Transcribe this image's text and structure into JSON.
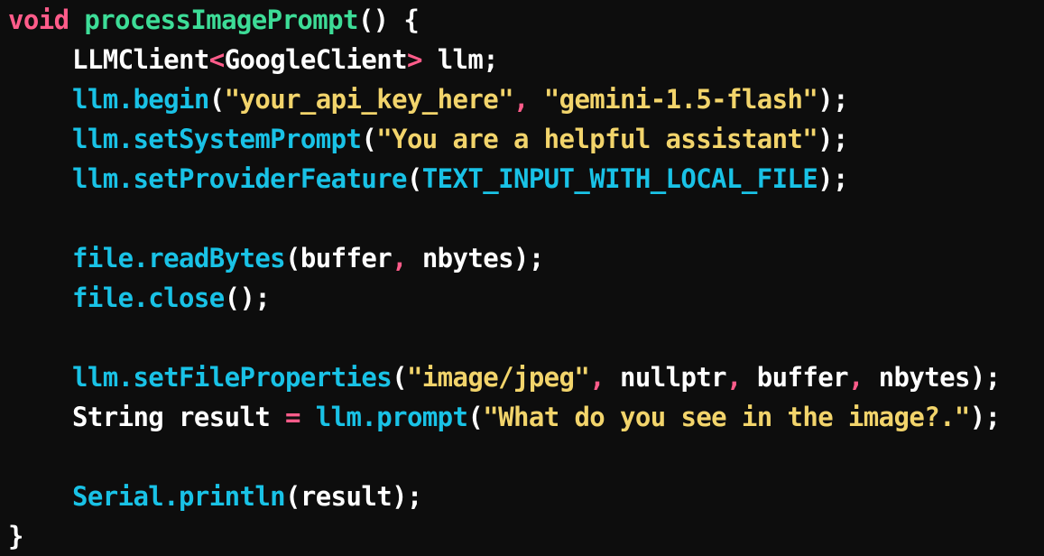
{
  "code": {
    "lines": [
      [
        {
          "t": "void",
          "c": "kw"
        },
        {
          "t": " ",
          "c": "plain"
        },
        {
          "t": "processImagePrompt",
          "c": "fn"
        },
        {
          "t": "() {",
          "c": "plain"
        }
      ],
      [
        {
          "t": "LLMClient",
          "c": "plain"
        },
        {
          "t": "<",
          "c": "punct-red"
        },
        {
          "t": "GoogleClient",
          "c": "plain"
        },
        {
          "t": ">",
          "c": "punct-red"
        },
        {
          "t": " llm;",
          "c": "plain"
        }
      ],
      [
        {
          "t": "llm.begin",
          "c": "obj"
        },
        {
          "t": "(",
          "c": "plain"
        },
        {
          "t": "\"your_api_key_here\"",
          "c": "str"
        },
        {
          "t": ",",
          "c": "punct-red"
        },
        {
          "t": " ",
          "c": "plain"
        },
        {
          "t": "\"gemini-1.5-flash\"",
          "c": "str"
        },
        {
          "t": ");",
          "c": "plain"
        }
      ],
      [
        {
          "t": "llm.setSystemPrompt",
          "c": "obj"
        },
        {
          "t": "(",
          "c": "plain"
        },
        {
          "t": "\"You are a helpful assistant\"",
          "c": "str"
        },
        {
          "t": ");",
          "c": "plain"
        }
      ],
      [
        {
          "t": "llm.setProviderFeature",
          "c": "obj"
        },
        {
          "t": "(",
          "c": "plain"
        },
        {
          "t": "TEXT_INPUT_WITH_LOCAL_FILE",
          "c": "const"
        },
        {
          "t": ");",
          "c": "plain"
        }
      ],
      [],
      [
        {
          "t": "file.readBytes",
          "c": "obj"
        },
        {
          "t": "(buffer",
          "c": "plain"
        },
        {
          "t": ",",
          "c": "punct-red"
        },
        {
          "t": " nbytes);",
          "c": "plain"
        }
      ],
      [
        {
          "t": "file.close",
          "c": "obj"
        },
        {
          "t": "();",
          "c": "plain"
        }
      ],
      [],
      [
        {
          "t": "llm.setFileProperties",
          "c": "obj"
        },
        {
          "t": "(",
          "c": "plain"
        },
        {
          "t": "\"image/jpeg\"",
          "c": "str"
        },
        {
          "t": ",",
          "c": "punct-red"
        },
        {
          "t": " nullptr",
          "c": "plain"
        },
        {
          "t": ",",
          "c": "punct-red"
        },
        {
          "t": " buffer",
          "c": "plain"
        },
        {
          "t": ",",
          "c": "punct-red"
        },
        {
          "t": " nbytes);",
          "c": "plain"
        }
      ],
      [
        {
          "t": "String result ",
          "c": "plain"
        },
        {
          "t": "=",
          "c": "punct-red"
        },
        {
          "t": " ",
          "c": "plain"
        },
        {
          "t": "llm.prompt",
          "c": "obj"
        },
        {
          "t": "(",
          "c": "plain"
        },
        {
          "t": "\"What do you see in the image?.\"",
          "c": "str"
        },
        {
          "t": ");",
          "c": "plain"
        }
      ],
      [],
      [
        {
          "t": "Serial.println",
          "c": "obj"
        },
        {
          "t": "(result);",
          "c": "plain"
        }
      ],
      [
        {
          "t": "}",
          "c": "plain"
        }
      ]
    ],
    "indented": [
      false,
      true,
      true,
      true,
      true,
      true,
      true,
      true,
      true,
      true,
      true,
      true,
      true,
      false
    ]
  }
}
